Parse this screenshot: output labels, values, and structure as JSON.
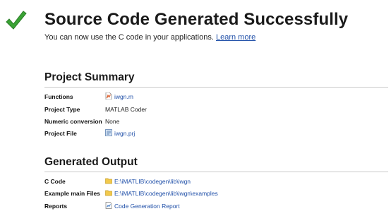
{
  "header": {
    "title": "Source Code Generated Successfully",
    "subtitle": "You can now use the C code in your applications.",
    "learn_more": "Learn more"
  },
  "project_summary": {
    "heading": "Project Summary",
    "rows": [
      {
        "label": "Functions",
        "value": "iwgn.m",
        "icon": "matlab-file-icon",
        "link": true
      },
      {
        "label": "Project Type",
        "value": "MATLAB Coder",
        "link": false
      },
      {
        "label": "Numeric conversion",
        "value": "None",
        "link": false
      },
      {
        "label": "Project File",
        "value": "iwgn.prj",
        "icon": "project-file-icon",
        "link": true
      }
    ]
  },
  "generated_output": {
    "heading": "Generated Output",
    "rows": [
      {
        "label": "C Code",
        "value": "E:\\iMATLIB\\codegen\\lib\\iwgn",
        "icon": "folder-icon",
        "link": true
      },
      {
        "label": "Example main Files",
        "value": "E:\\iMATLIB\\codegen\\lib\\iwgn\\examples",
        "icon": "folder-icon",
        "link": true
      },
      {
        "label": "Reports",
        "value": "Code Generation Report",
        "icon": "report-icon",
        "link": true
      }
    ]
  },
  "colors": {
    "link": "#1f4fa8",
    "check": "#3aa335",
    "folder": "#f2c94c"
  }
}
